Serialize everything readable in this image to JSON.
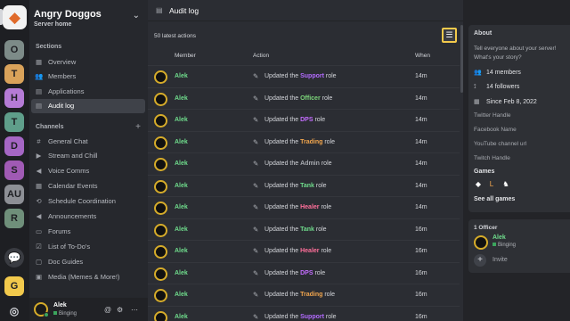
{
  "rail": {
    "servers": [
      {
        "label": "O",
        "color": "#7d8b88"
      },
      {
        "label": "T",
        "color": "#d9a25a"
      },
      {
        "label": "H",
        "color": "#b57bd6"
      },
      {
        "label": "T",
        "color": "#5f9e8a"
      },
      {
        "label": "D",
        "color": "#a566c4"
      },
      {
        "label": "S",
        "color": "#a05ab4"
      },
      {
        "label": "AU",
        "color": "#8d8f95"
      },
      {
        "label": "R",
        "color": "#6f8f7a"
      }
    ]
  },
  "server": {
    "name": "Angry Doggos",
    "subtitle": "Server home"
  },
  "sections": {
    "title": "Sections",
    "items": [
      {
        "label": "Overview",
        "icon": "grid-icon"
      },
      {
        "label": "Members",
        "icon": "members-icon"
      },
      {
        "label": "Applications",
        "icon": "applications-icon"
      },
      {
        "label": "Audit log",
        "icon": "audit-log-icon",
        "active": true
      }
    ]
  },
  "channels": {
    "title": "Channels",
    "items": [
      {
        "label": "General Chat",
        "icon": "hash-icon"
      },
      {
        "label": "Stream and Chill",
        "icon": "stream-icon"
      },
      {
        "label": "Voice Comms",
        "icon": "speaker-icon"
      },
      {
        "label": "Calendar Events",
        "icon": "calendar-icon"
      },
      {
        "label": "Schedule Coordination",
        "icon": "schedule-icon"
      },
      {
        "label": "Announcements",
        "icon": "megaphone-icon"
      },
      {
        "label": "Forums",
        "icon": "forum-icon"
      },
      {
        "label": "List of To-Do's",
        "icon": "checklist-icon"
      },
      {
        "label": "Doc Guides",
        "icon": "doc-icon"
      },
      {
        "label": "Media (Memes & More!)",
        "icon": "media-icon"
      }
    ]
  },
  "user": {
    "name": "Alek",
    "status": "Binging"
  },
  "header": {
    "title": "Audit log"
  },
  "audit": {
    "count_label": "50 latest actions",
    "columns": {
      "member": "Member",
      "action": "Action",
      "when": "When"
    },
    "rows": [
      {
        "member": "Alek",
        "prefix": "Updated the",
        "role": "Support",
        "role_color": "#b36bff",
        "suffix": "role",
        "when": "14m"
      },
      {
        "member": "Alek",
        "prefix": "Updated the",
        "role": "Officer",
        "role_color": "#7cd67a",
        "suffix": "role",
        "when": "14m"
      },
      {
        "member": "Alek",
        "prefix": "Updated the",
        "role": "DPS",
        "role_color": "#c46dff",
        "suffix": "role",
        "when": "14m"
      },
      {
        "member": "Alek",
        "prefix": "Updated the",
        "role": "Trading",
        "role_color": "#f2a64e",
        "suffix": "role",
        "when": "14m"
      },
      {
        "member": "Alek",
        "prefix": "Updated the",
        "role": "Admin",
        "role_color": "#a7aab0",
        "suffix": "role",
        "when": "14m"
      },
      {
        "member": "Alek",
        "prefix": "Updated the",
        "role": "Tank",
        "role_color": "#6fdc8c",
        "suffix": "role",
        "when": "14m"
      },
      {
        "member": "Alek",
        "prefix": "Updated the",
        "role": "Healer",
        "role_color": "#ff6f9a",
        "suffix": "role",
        "when": "14m"
      },
      {
        "member": "Alek",
        "prefix": "Updated the",
        "role": "Tank",
        "role_color": "#6fdc8c",
        "suffix": "role",
        "when": "16m"
      },
      {
        "member": "Alek",
        "prefix": "Updated the",
        "role": "Healer",
        "role_color": "#ff6f9a",
        "suffix": "role",
        "when": "16m"
      },
      {
        "member": "Alek",
        "prefix": "Updated the",
        "role": "DPS",
        "role_color": "#c46dff",
        "suffix": "role",
        "when": "16m"
      },
      {
        "member": "Alek",
        "prefix": "Updated the",
        "role": "Trading",
        "role_color": "#f2a64e",
        "suffix": "role",
        "when": "16m"
      },
      {
        "member": "Alek",
        "prefix": "Updated the",
        "role": "Support",
        "role_color": "#b36bff",
        "suffix": "role",
        "when": "16m"
      }
    ]
  },
  "about": {
    "title": "About",
    "description": "Tell everyone about your server! What's your story?",
    "members": "14 members",
    "followers": "14 followers",
    "since": "Since Feb 8, 2022",
    "links": [
      "Twitter Handle",
      "Facebook Name",
      "YouTube channel url",
      "Twitch Handle"
    ],
    "games_title": "Games",
    "see_all": "See all games"
  },
  "officers": {
    "title": "1 Officer",
    "name": "Alek",
    "status": "Binging",
    "invite": "Invite"
  }
}
